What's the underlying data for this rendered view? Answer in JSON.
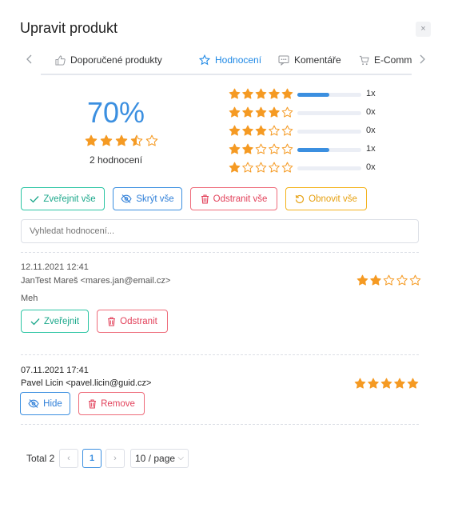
{
  "modal": {
    "title": "Upravit produkt",
    "close_glyph": "×"
  },
  "tabs": [
    {
      "label": "Doporučené produkty",
      "icon": "thumb-up-icon",
      "active": false
    },
    {
      "label": "Hodnocení",
      "icon": "star-icon",
      "active": true
    },
    {
      "label": "Komentáře",
      "icon": "comment-icon",
      "active": false
    },
    {
      "label": "E-Commerce",
      "icon": "cart-icon",
      "active": false
    }
  ],
  "summary": {
    "percent": "70%",
    "stars": 3.5,
    "count_label": "2 hodnocení"
  },
  "distribution": [
    {
      "stars": 5,
      "count": "1x",
      "fraction": 0.5
    },
    {
      "stars": 4,
      "count": "0x",
      "fraction": 0
    },
    {
      "stars": 3,
      "count": "0x",
      "fraction": 0
    },
    {
      "stars": 2,
      "count": "1x",
      "fraction": 0.5
    },
    {
      "stars": 1,
      "count": "0x",
      "fraction": 0
    }
  ],
  "bulk_actions": {
    "publish_all": "Zveřejnit vše",
    "hide_all": "Skrýt vše",
    "delete_all": "Odstranit vše",
    "restore_all": "Obnovit vše"
  },
  "search": {
    "placeholder": "Vyhledat hodnocení..."
  },
  "reviews": [
    {
      "date": "12.11.2021 12:41",
      "author": "JanTest Mareš <mares.jan@email.cz>",
      "text": "Meh",
      "stars": 2,
      "primary_action": "Zveřejnit",
      "delete_action": "Odstranit"
    },
    {
      "date": "07.11.2021 17:41",
      "author": "Pavel Licin <pavel.licin@guid.cz>",
      "text": "",
      "stars": 5,
      "primary_action": "Hide",
      "delete_action": "Remove"
    }
  ],
  "pagination": {
    "total": "Total 2",
    "current_page": "1",
    "page_size": "10 / page",
    "prev": "‹",
    "next": "›",
    "size_chevron": "⌵"
  },
  "colors": {
    "accent": "#3b8fe0",
    "star": "#f59a23",
    "star_empty": "#f59a23"
  }
}
